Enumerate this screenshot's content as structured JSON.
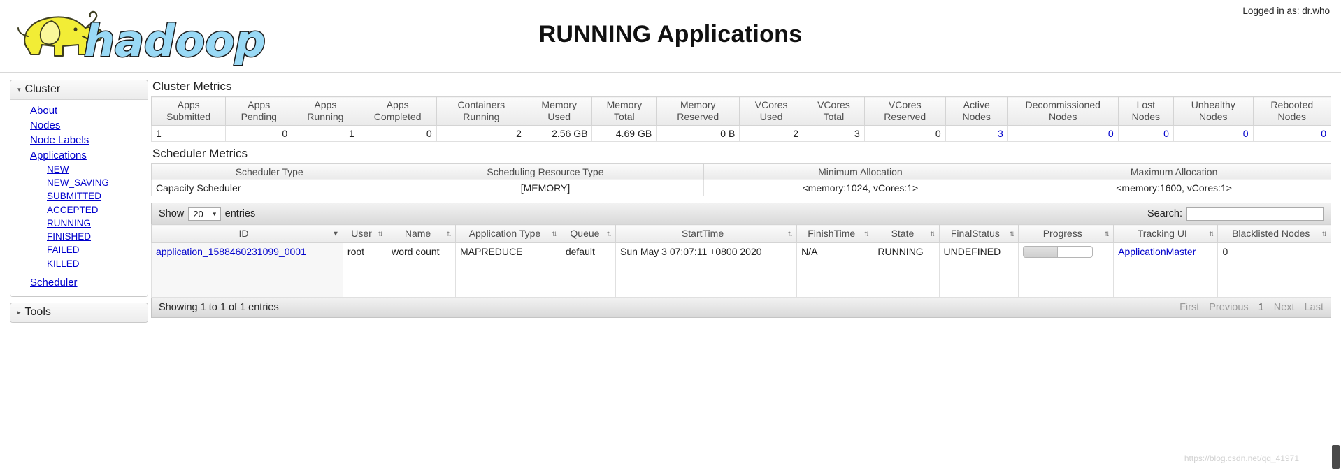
{
  "header": {
    "title": "RUNNING Applications",
    "login_label": "Logged in as: dr.who",
    "logo_text": "hadoop",
    "logo_icon": "hadoop-elephant-logo"
  },
  "sidebar": {
    "cluster": {
      "label": "Cluster",
      "expanded": true,
      "triangle": "▾",
      "links": [
        "About",
        "Nodes",
        "Node Labels",
        "Applications"
      ],
      "app_states": [
        "NEW",
        "NEW_SAVING",
        "SUBMITTED",
        "ACCEPTED",
        "RUNNING",
        "FINISHED",
        "FAILED",
        "KILLED"
      ],
      "scheduler_link": "Scheduler"
    },
    "tools": {
      "label": "Tools",
      "expanded": false,
      "triangle": "▸"
    }
  },
  "cluster_metrics": {
    "title": "Cluster Metrics",
    "headers": [
      "Apps Submitted",
      "Apps Pending",
      "Apps Running",
      "Apps Completed",
      "Containers Running",
      "Memory Used",
      "Memory Total",
      "Memory Reserved",
      "VCores Used",
      "VCores Total",
      "VCores Reserved",
      "Active Nodes",
      "Decommissioned Nodes",
      "Lost Nodes",
      "Unhealthy Nodes",
      "Rebooted Nodes"
    ],
    "values": [
      "1",
      "0",
      "1",
      "0",
      "2",
      "2.56 GB",
      "4.69 GB",
      "0 B",
      "2",
      "3",
      "0",
      "3",
      "0",
      "0",
      "0",
      "0"
    ],
    "link_flags": [
      false,
      false,
      false,
      false,
      false,
      false,
      false,
      false,
      false,
      false,
      false,
      true,
      true,
      true,
      true,
      true
    ]
  },
  "scheduler_metrics": {
    "title": "Scheduler Metrics",
    "headers": [
      "Scheduler Type",
      "Scheduling Resource Type",
      "Minimum Allocation",
      "Maximum Allocation"
    ],
    "values": [
      "Capacity Scheduler",
      "[MEMORY]",
      "<memory:1024, vCores:1>",
      "<memory:1600, vCores:1>"
    ]
  },
  "apps": {
    "show_label": "Show",
    "entries_label": "entries",
    "page_length": "20",
    "search_label": "Search:",
    "search_value": "",
    "search_placeholder": "",
    "columns": [
      {
        "label": "ID",
        "sort": "desc"
      },
      {
        "label": "User",
        "sort": "both"
      },
      {
        "label": "Name",
        "sort": "both"
      },
      {
        "label": "Application Type",
        "sort": "both"
      },
      {
        "label": "Queue",
        "sort": "both"
      },
      {
        "label": "StartTime",
        "sort": "both"
      },
      {
        "label": "FinishTime",
        "sort": "both"
      },
      {
        "label": "State",
        "sort": "both"
      },
      {
        "label": "FinalStatus",
        "sort": "both"
      },
      {
        "label": "Progress",
        "sort": "both"
      },
      {
        "label": "Tracking UI",
        "sort": "both"
      },
      {
        "label": "Blacklisted Nodes",
        "sort": "both"
      }
    ],
    "rows": [
      {
        "id": "application_1588460231099_0001",
        "user": "root",
        "name": "word count",
        "app_type": "MAPREDUCE",
        "queue": "default",
        "start_time": "Sun May 3 07:07:11 +0800 2020",
        "finish_time": "N/A",
        "state": "RUNNING",
        "final_status": "UNDEFINED",
        "progress_percent": 50,
        "tracking_ui": "ApplicationMaster",
        "blacklisted_nodes": "0"
      }
    ],
    "footer_info": "Showing 1 to 1 of 1 entries",
    "pager": [
      "First",
      "Previous",
      "1",
      "Next",
      "Last"
    ]
  },
  "watermark": "https://blog.csdn.net/qq_41971",
  "colors": {
    "link": "#0000cc",
    "logo_yellow": "#f2ed36",
    "logo_blue": "#99d9f5",
    "header_text": "#4d4d4d"
  }
}
